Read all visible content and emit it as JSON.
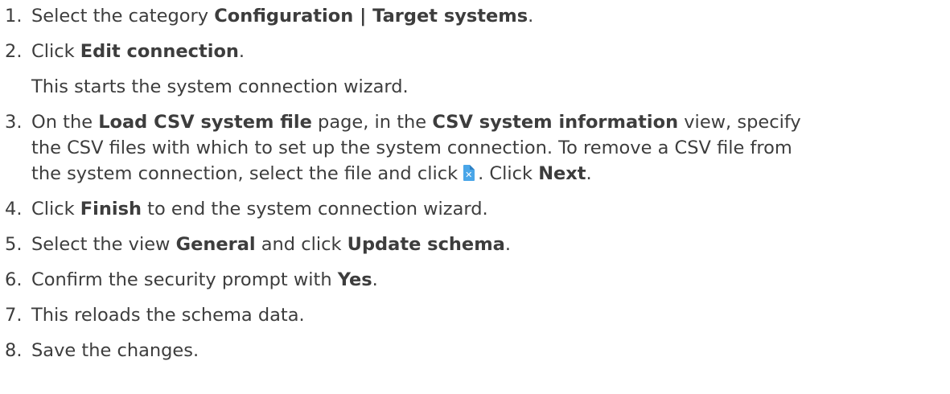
{
  "steps": [
    {
      "num": "1.",
      "t1": "Select the category ",
      "b1": "Configuration | Target systems",
      "t2": "."
    },
    {
      "num": "2.",
      "t1": "Click ",
      "b1": "Edit connection",
      "t2": ".",
      "sub": "This starts the system connection wizard."
    },
    {
      "num": "3.",
      "t1": "On the ",
      "b1": "Load CSV system file",
      "t2": " page, in the ",
      "b2": "CSV system information",
      "t3": " view, specify",
      "line2": "the CSV files with which to set up the system connection. To remove a CSV file from",
      "line3a": "the system connection, select the file and click",
      "icon": "remove-csv-file-icon",
      "line3b": ". Click ",
      "b3": "Next",
      "line3c": "."
    },
    {
      "num": "4.",
      "t1": "Click ",
      "b1": "Finish",
      "t2": " to end the system connection wizard."
    },
    {
      "num": "5.",
      "t1": "Select the view ",
      "b1": "General",
      "t2": " and click ",
      "b2": "Update schema",
      "t3": "."
    },
    {
      "num": "6.",
      "t1": "Confirm the security prompt with ",
      "b1": "Yes",
      "t2": "."
    },
    {
      "num": "7.",
      "t1": "This reloads the schema data."
    },
    {
      "num": "8.",
      "t1": "Save the changes."
    }
  ]
}
